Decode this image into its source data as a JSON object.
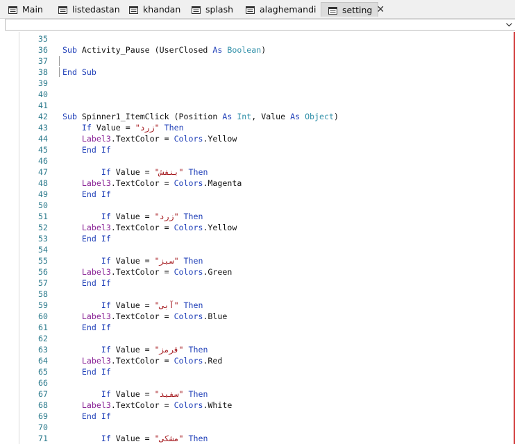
{
  "tabs": [
    {
      "label": "Main",
      "active": false
    },
    {
      "label": "listedastan",
      "active": false
    },
    {
      "label": "khandan",
      "active": false
    },
    {
      "label": "splash",
      "active": false
    },
    {
      "label": "alaghemandi",
      "active": false
    },
    {
      "label": "setting",
      "active": true
    }
  ],
  "close_glyph": "✕",
  "tab_icon": "code-module-icon",
  "colors": {
    "keyword": "#1f3fb8",
    "type": "#2f8fa8",
    "string": "#a3151a",
    "object_member": "#8a2496",
    "line_number": "#2b7a8c",
    "accent_border": "#d23a3a"
  },
  "editor": {
    "lines": [
      {
        "n": "35",
        "parts": []
      },
      {
        "n": "36",
        "parts": [
          [
            "kw",
            "Sub"
          ],
          [
            "pl",
            " Activity_Pause (UserClosed "
          ],
          [
            "kw",
            "As"
          ],
          [
            "pl",
            " "
          ],
          [
            "ty",
            "Boolean"
          ],
          [
            "pl",
            ")"
          ]
        ]
      },
      {
        "n": "37",
        "parts": [],
        "fold": true
      },
      {
        "n": "38",
        "parts": [
          [
            "kw",
            "End Sub"
          ]
        ],
        "fold": true
      },
      {
        "n": "39",
        "parts": []
      },
      {
        "n": "40",
        "parts": []
      },
      {
        "n": "41",
        "parts": []
      },
      {
        "n": "42",
        "parts": [
          [
            "kw",
            "Sub"
          ],
          [
            "pl",
            " Spinner1_ItemClick (Position "
          ],
          [
            "kw",
            "As"
          ],
          [
            "pl",
            " "
          ],
          [
            "ty",
            "Int"
          ],
          [
            "pl",
            ", Value "
          ],
          [
            "kw",
            "As"
          ],
          [
            "pl",
            " "
          ],
          [
            "ty",
            "Object"
          ],
          [
            "pl",
            ")"
          ]
        ]
      },
      {
        "n": "43",
        "parts": [
          [
            "pl",
            "    "
          ],
          [
            "kw",
            "If"
          ],
          [
            "pl",
            " Value = "
          ],
          [
            "str",
            "\"زرد\""
          ],
          [
            "pl",
            " "
          ],
          [
            "kw",
            "Then"
          ]
        ]
      },
      {
        "n": "44",
        "parts": [
          [
            "pl",
            "    "
          ],
          [
            "lbl",
            "Label3"
          ],
          [
            "pl",
            ".TextColor = "
          ],
          [
            "obj",
            "Colors"
          ],
          [
            "pl",
            ".Yellow"
          ]
        ]
      },
      {
        "n": "45",
        "parts": [
          [
            "pl",
            "    "
          ],
          [
            "kw",
            "End If"
          ]
        ]
      },
      {
        "n": "46",
        "parts": []
      },
      {
        "n": "47",
        "parts": [
          [
            "pl",
            "        "
          ],
          [
            "kw",
            "If"
          ],
          [
            "pl",
            " Value = "
          ],
          [
            "str",
            "\"بنفش\""
          ],
          [
            "pl",
            " "
          ],
          [
            "kw",
            "Then"
          ]
        ]
      },
      {
        "n": "48",
        "parts": [
          [
            "pl",
            "    "
          ],
          [
            "lbl",
            "Label3"
          ],
          [
            "pl",
            ".TextColor = "
          ],
          [
            "obj",
            "Colors"
          ],
          [
            "pl",
            ".Magenta"
          ]
        ]
      },
      {
        "n": "49",
        "parts": [
          [
            "pl",
            "    "
          ],
          [
            "kw",
            "End If"
          ]
        ]
      },
      {
        "n": "50",
        "parts": []
      },
      {
        "n": "51",
        "parts": [
          [
            "pl",
            "        "
          ],
          [
            "kw",
            "If"
          ],
          [
            "pl",
            " Value = "
          ],
          [
            "str",
            "\"زرد\""
          ],
          [
            "pl",
            " "
          ],
          [
            "kw",
            "Then"
          ]
        ]
      },
      {
        "n": "52",
        "parts": [
          [
            "pl",
            "    "
          ],
          [
            "lbl",
            "Label3"
          ],
          [
            "pl",
            ".TextColor = "
          ],
          [
            "obj",
            "Colors"
          ],
          [
            "pl",
            ".Yellow"
          ]
        ]
      },
      {
        "n": "53",
        "parts": [
          [
            "pl",
            "    "
          ],
          [
            "kw",
            "End If"
          ]
        ]
      },
      {
        "n": "54",
        "parts": []
      },
      {
        "n": "55",
        "parts": [
          [
            "pl",
            "        "
          ],
          [
            "kw",
            "If"
          ],
          [
            "pl",
            " Value = "
          ],
          [
            "str",
            "\"سبز\""
          ],
          [
            "pl",
            " "
          ],
          [
            "kw",
            "Then"
          ]
        ]
      },
      {
        "n": "56",
        "parts": [
          [
            "pl",
            "    "
          ],
          [
            "lbl",
            "Label3"
          ],
          [
            "pl",
            ".TextColor = "
          ],
          [
            "obj",
            "Colors"
          ],
          [
            "pl",
            ".Green"
          ]
        ]
      },
      {
        "n": "57",
        "parts": [
          [
            "pl",
            "    "
          ],
          [
            "kw",
            "End If"
          ]
        ]
      },
      {
        "n": "58",
        "parts": []
      },
      {
        "n": "59",
        "parts": [
          [
            "pl",
            "        "
          ],
          [
            "kw",
            "If"
          ],
          [
            "pl",
            " Value = "
          ],
          [
            "str",
            "\"آبی\""
          ],
          [
            "pl",
            " "
          ],
          [
            "kw",
            "Then"
          ]
        ]
      },
      {
        "n": "60",
        "parts": [
          [
            "pl",
            "    "
          ],
          [
            "lbl",
            "Label3"
          ],
          [
            "pl",
            ".TextColor = "
          ],
          [
            "obj",
            "Colors"
          ],
          [
            "pl",
            ".Blue"
          ]
        ]
      },
      {
        "n": "61",
        "parts": [
          [
            "pl",
            "    "
          ],
          [
            "kw",
            "End If"
          ]
        ]
      },
      {
        "n": "62",
        "parts": []
      },
      {
        "n": "63",
        "parts": [
          [
            "pl",
            "        "
          ],
          [
            "kw",
            "If"
          ],
          [
            "pl",
            " Value = "
          ],
          [
            "str",
            "\"قرمز\""
          ],
          [
            "pl",
            " "
          ],
          [
            "kw",
            "Then"
          ]
        ]
      },
      {
        "n": "64",
        "parts": [
          [
            "pl",
            "    "
          ],
          [
            "lbl",
            "Label3"
          ],
          [
            "pl",
            ".TextColor = "
          ],
          [
            "obj",
            "Colors"
          ],
          [
            "pl",
            ".Red"
          ]
        ]
      },
      {
        "n": "65",
        "parts": [
          [
            "pl",
            "    "
          ],
          [
            "kw",
            "End If"
          ]
        ]
      },
      {
        "n": "66",
        "parts": []
      },
      {
        "n": "67",
        "parts": [
          [
            "pl",
            "        "
          ],
          [
            "kw",
            "If"
          ],
          [
            "pl",
            " Value = "
          ],
          [
            "str",
            "\"سفید\""
          ],
          [
            "pl",
            " "
          ],
          [
            "kw",
            "Then"
          ]
        ]
      },
      {
        "n": "68",
        "parts": [
          [
            "pl",
            "    "
          ],
          [
            "lbl",
            "Label3"
          ],
          [
            "pl",
            ".TextColor = "
          ],
          [
            "obj",
            "Colors"
          ],
          [
            "pl",
            ".White"
          ]
        ]
      },
      {
        "n": "69",
        "parts": [
          [
            "pl",
            "    "
          ],
          [
            "kw",
            "End If"
          ]
        ]
      },
      {
        "n": "70",
        "parts": []
      },
      {
        "n": "71",
        "parts": [
          [
            "pl",
            "        "
          ],
          [
            "kw",
            "If"
          ],
          [
            "pl",
            " Value = "
          ],
          [
            "str",
            "\"مشکی\""
          ],
          [
            "pl",
            " "
          ],
          [
            "kw",
            "Then"
          ]
        ]
      }
    ]
  }
}
